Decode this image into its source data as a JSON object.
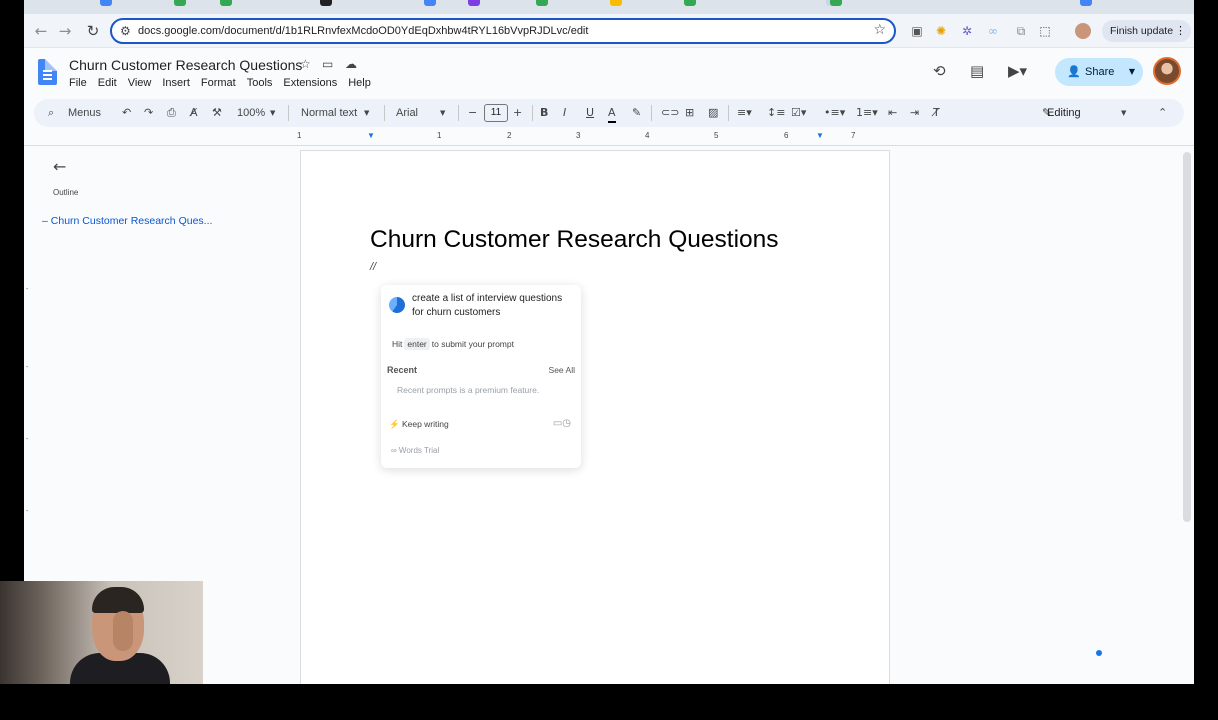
{
  "browser": {
    "url": "docs.google.com/document/d/1b1RLRnvfexMcdoOD0YdEqDxhbw4tRYL16bVvpRJDLvc/edit",
    "finish_update_label": "Finish update"
  },
  "doc": {
    "title": "Churn Customer Research Questions",
    "menus": [
      "File",
      "Edit",
      "View",
      "Insert",
      "Format",
      "Tools",
      "Extensions",
      "Help"
    ],
    "share_label": "Share"
  },
  "toolbar": {
    "search_label": "Menus",
    "zoom": "100%",
    "style": "Normal text",
    "font": "Arial",
    "font_size": "11",
    "mode": "Editing"
  },
  "ruler": {
    "numbers": [
      "1",
      "1",
      "2",
      "3",
      "4",
      "5",
      "6",
      "7"
    ]
  },
  "outline": {
    "label": "Outline",
    "item": "Churn Customer Research Ques..."
  },
  "page": {
    "heading": "Churn Customer Research Questions",
    "typed": "//"
  },
  "popup": {
    "prompt": "create a list of interview questions for churn customers",
    "hint_before": "Hit",
    "hint_key": "enter",
    "hint_after": "to submit your prompt",
    "recent_label": "Recent",
    "see_all": "See All",
    "premium_note": "Recent prompts is a premium feature.",
    "keep_writing": "Keep writing",
    "trial": "∞ Words Trial"
  },
  "colors": {
    "accent": "#0b57d0",
    "share_bg": "#c2e7ff",
    "omnibox_border": "#1a56c9"
  }
}
